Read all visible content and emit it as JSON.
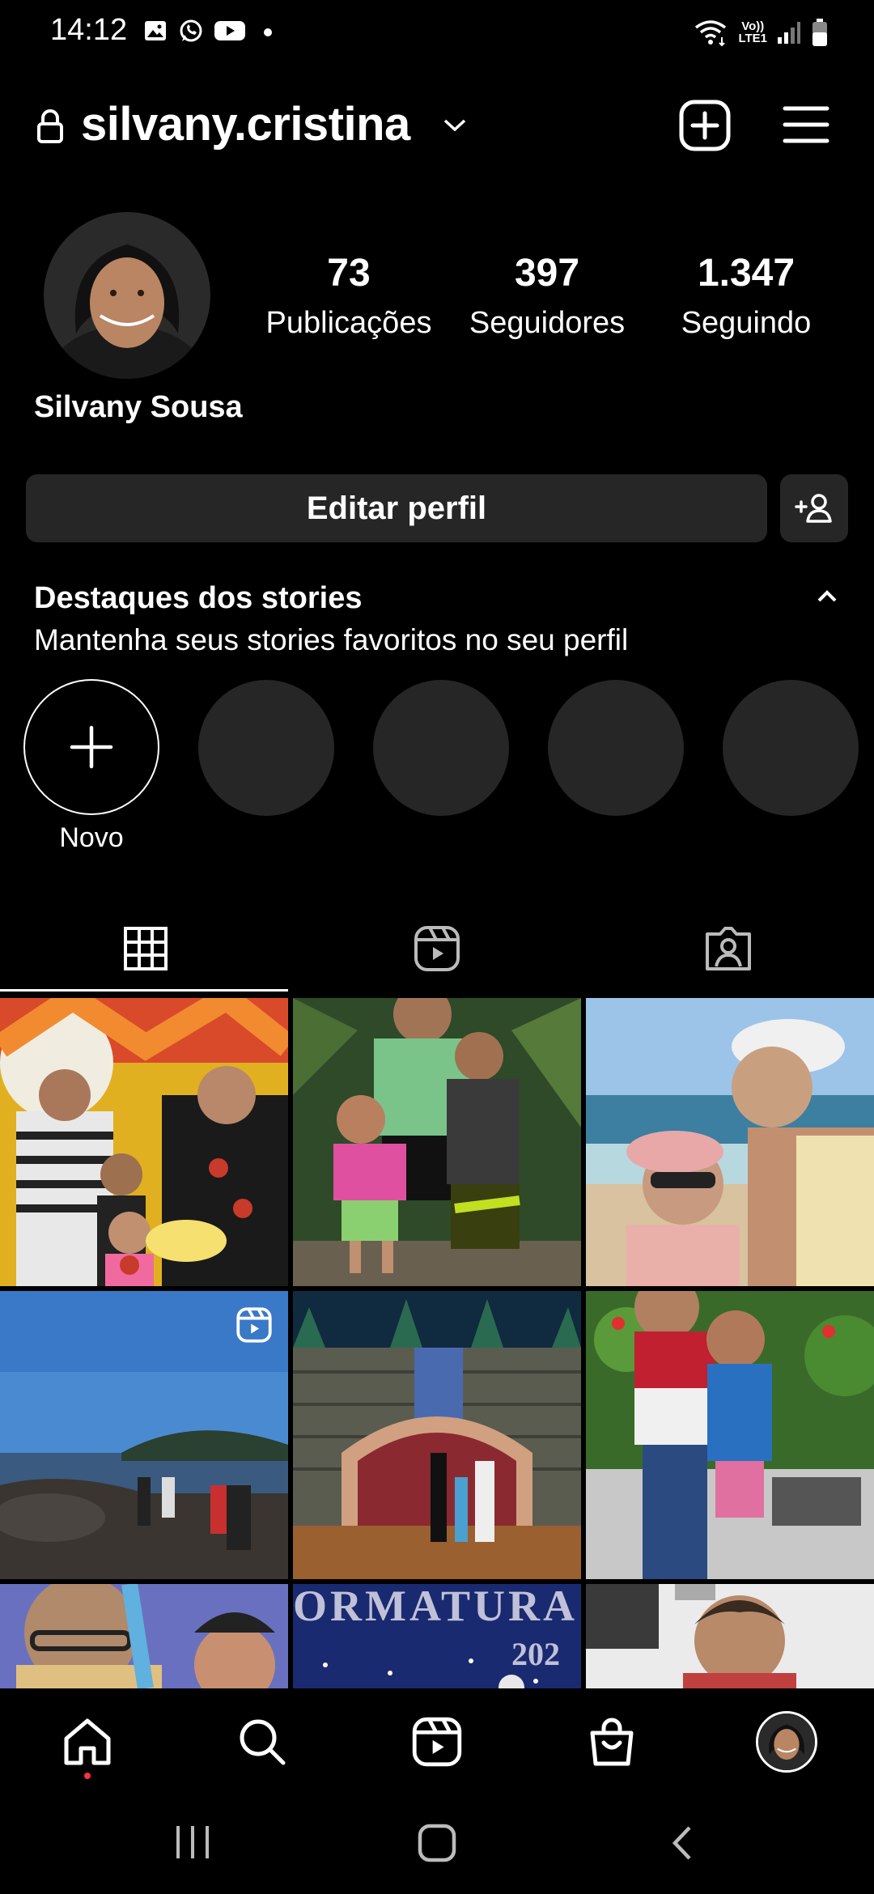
{
  "status_bar": {
    "time": "14:12",
    "left_icons": [
      "gallery-icon",
      "whatsapp-icon",
      "youtube-icon",
      "dot-icon"
    ],
    "right_icons": [
      "wifi-icon",
      "volte-icon",
      "signal-icon",
      "battery-icon"
    ],
    "volte_line1": "Vo))",
    "volte_line2": "LTE1"
  },
  "header": {
    "username": "silvany.cristina"
  },
  "profile": {
    "display_name": "Silvany Sousa",
    "stats": [
      {
        "value": "73",
        "label": "Publicações"
      },
      {
        "value": "397",
        "label": "Seguidores"
      },
      {
        "value": "1.347",
        "label": "Seguindo"
      }
    ],
    "edit_button": "Editar perfil"
  },
  "highlights": {
    "title": "Destaques dos stories",
    "subtitle": "Mantenha seus stories favoritos no seu perfil",
    "new_label": "Novo"
  },
  "tabs": [
    "grid-icon",
    "reels-icon",
    "tagged-icon"
  ],
  "bottom_nav": [
    "home-icon",
    "search-icon",
    "reels-icon",
    "shop-icon",
    "profile-avatar"
  ],
  "colors": {
    "background": "#000000",
    "button_bg": "#262626",
    "notification_dot": "#ff3040"
  }
}
